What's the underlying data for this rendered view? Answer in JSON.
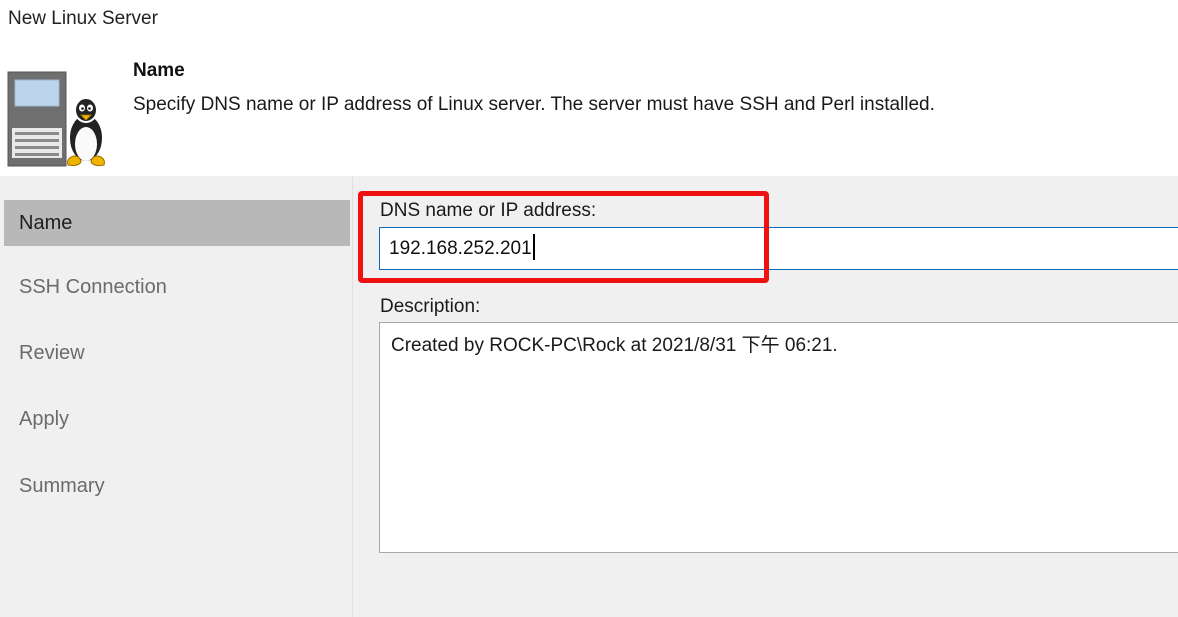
{
  "window": {
    "title": "New Linux Server"
  },
  "header": {
    "heading": "Name",
    "description": "Specify DNS name or IP address of Linux server. The server must have SSH and Perl installed.",
    "icon": "linux-server-icon"
  },
  "sidebar": {
    "items": [
      {
        "label": "Name",
        "active": true
      },
      {
        "label": "SSH Connection",
        "active": false
      },
      {
        "label": "Review",
        "active": false
      },
      {
        "label": "Apply",
        "active": false
      },
      {
        "label": "Summary",
        "active": false
      }
    ]
  },
  "form": {
    "dns_label": "DNS name or IP address:",
    "dns_value": "192.168.252.201",
    "description_label": "Description:",
    "description_value": "Created by ROCK-PC\\Rock at 2021/8/31 下午 06:21."
  },
  "colors": {
    "highlight": "#ee1111",
    "active_item_bg": "#b8b8b8",
    "input_focus_border": "#0f6cbd"
  }
}
